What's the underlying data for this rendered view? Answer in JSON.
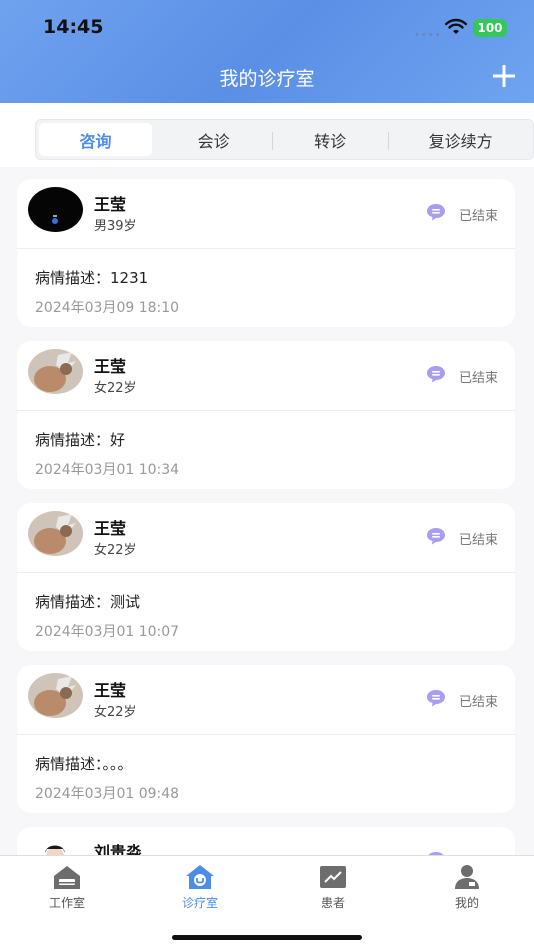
{
  "status_bar": {
    "time": "14:45",
    "battery": "100"
  },
  "header": {
    "title": "我的诊疗室",
    "add_icon": "plus-icon"
  },
  "tabs": [
    {
      "label": "咨询",
      "active": true
    },
    {
      "label": "会诊",
      "active": false
    },
    {
      "label": "转诊",
      "active": false
    },
    {
      "label": "复诊续方",
      "active": false
    }
  ],
  "consultations": [
    {
      "name": "王莹",
      "meta": "男39岁",
      "status": "已结束",
      "description": "病情描述：1231",
      "date": "2024年03月09 18:10"
    },
    {
      "name": "王莹",
      "meta": "女22岁",
      "status": "已结束",
      "description": "病情描述：好",
      "date": "2024年03月01 10:34"
    },
    {
      "name": "王莹",
      "meta": "女22岁",
      "status": "已结束",
      "description": "病情描述：测试",
      "date": "2024年03月01 10:07"
    },
    {
      "name": "王莹",
      "meta": "女22岁",
      "status": "已结束",
      "description": "病情描述：。。。",
      "date": "2024年03月01 09:48"
    },
    {
      "name": "刘贵淼",
      "meta": "",
      "status": "",
      "description": "",
      "date": ""
    }
  ],
  "bottom_nav": [
    {
      "label": "工作室",
      "icon": "workspace-icon",
      "active": false
    },
    {
      "label": "诊疗室",
      "icon": "clinic-icon",
      "active": true
    },
    {
      "label": "患者",
      "icon": "patients-icon",
      "active": false
    },
    {
      "label": "我的",
      "icon": "profile-icon",
      "active": false
    }
  ],
  "colors": {
    "accent": "#4d8de8",
    "header_bg": "#5b8fe6",
    "chat_icon": "#a99cf2",
    "battery": "#34c759"
  }
}
